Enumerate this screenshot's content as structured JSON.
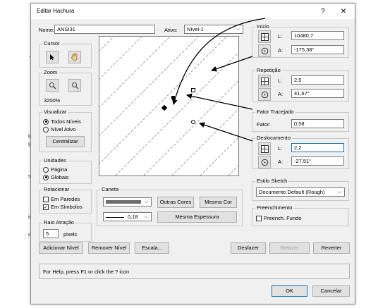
{
  "dialog": {
    "title": "Editar Hachura",
    "help_glyph": "?",
    "close_glyph": "✕"
  },
  "name": {
    "label": "Nome:",
    "value": "ANSI31"
  },
  "active": {
    "label": "Ativo:",
    "value": "Nível-1"
  },
  "cursor": {
    "title": "Cursor"
  },
  "zoom": {
    "title": "Zoom",
    "percent": "3200%"
  },
  "visualizar": {
    "title": "Visualizar",
    "options": [
      "Todos Níveis",
      "Nível Ativo"
    ],
    "selected": 0,
    "button": "Centralizar"
  },
  "unidades": {
    "title": "Unidades",
    "options": [
      "Página",
      "Globais"
    ],
    "selected": 1
  },
  "rotacionar": {
    "title": "Rotacionar",
    "options": [
      {
        "label": "Em Paredes",
        "checked": false
      },
      {
        "label": "Em Símbolos",
        "checked": true
      }
    ]
  },
  "raio": {
    "title": "Raio Atração",
    "value": "5",
    "unit": "pixels"
  },
  "caneta": {
    "title": "Caneta",
    "line_width": "0,18",
    "buttons": [
      "Outras Cores",
      "Mesma Cor",
      "Mesma Espessura"
    ]
  },
  "inicio": {
    "title": "Início",
    "L_label": "L:",
    "L": "10480,7",
    "A_label": "A:",
    "A": "-175,38°"
  },
  "repeticao": {
    "title": "Repetição",
    "L_label": "L:",
    "L": "2,5",
    "A_label": "A:",
    "A": "41,67°"
  },
  "fator": {
    "title": "Fator Tracejado",
    "label": "Fator:",
    "value": "0,58"
  },
  "deslocamento": {
    "title": "Deslocamento",
    "L_label": "L:",
    "L": "2,2",
    "A_label": "A:",
    "A": "-27,51°"
  },
  "sketch": {
    "title": "Estilo Sketch",
    "value": "Documento Default (Rough)"
  },
  "preenchimento": {
    "title": "Preenchimento",
    "checkbox": "Preench. Fundo",
    "checked": false
  },
  "bottom_buttons": [
    "Adicionar Nível",
    "Remover Nível",
    "Escala...",
    "Desfazer",
    "Refazer",
    "Reverter"
  ],
  "status": "For Help, press F1 or click the ? icon",
  "footer_buttons": [
    "OK",
    "Cancelar"
  ],
  "colors": {
    "dialog_bg": "#f0f0f0",
    "focus_border": "#0078d7",
    "disabled_text": "#a0a0a0"
  }
}
